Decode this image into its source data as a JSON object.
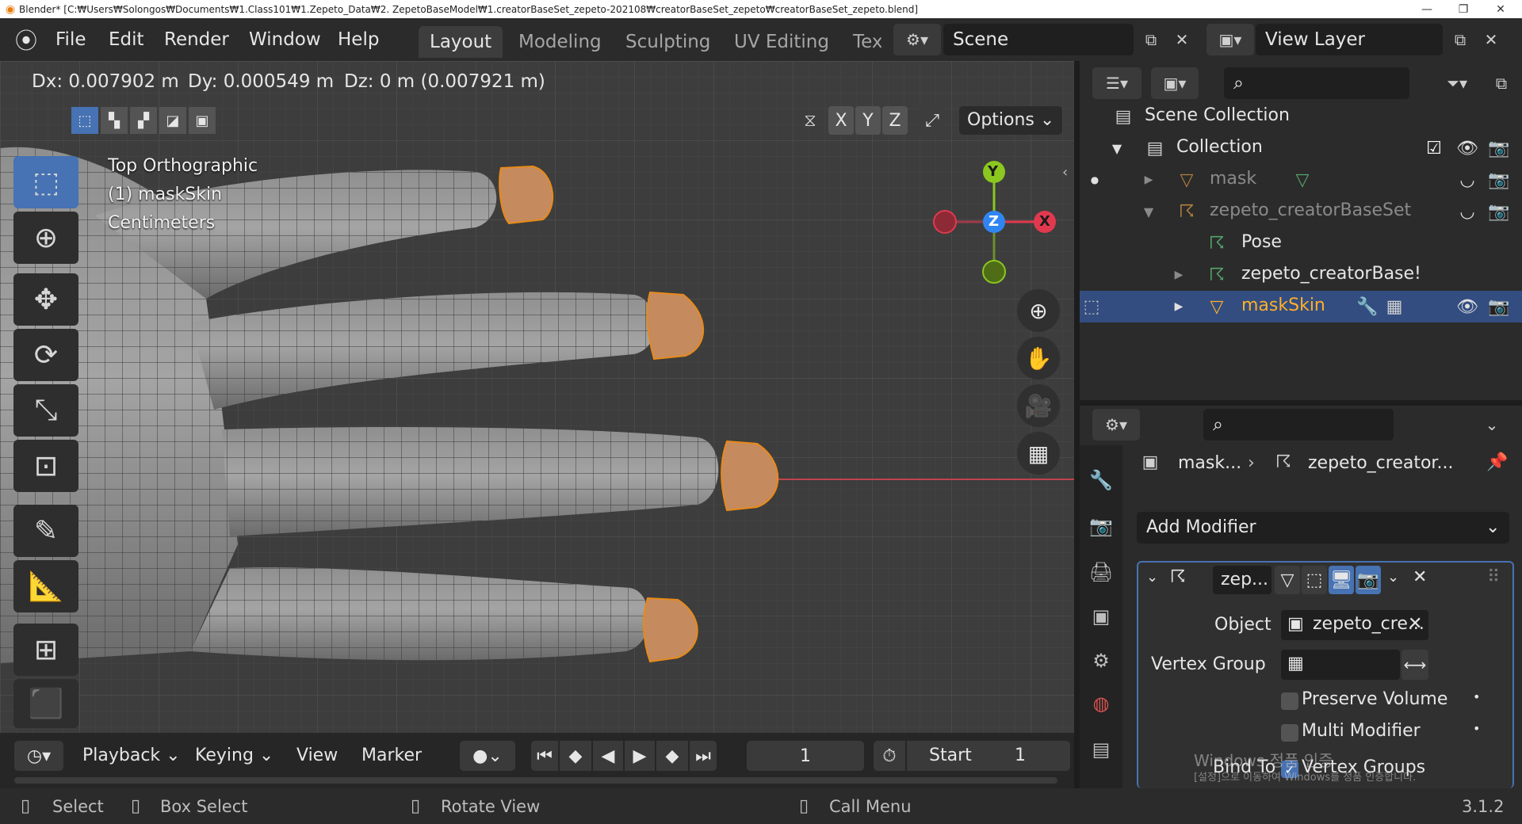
{
  "titlebar": {
    "title": "Blender* [C:₩Users₩Solongos₩Documents₩1.Class101₩1.Zepeto_Data₩2. ZepetoBaseModel₩1.creatorBaseSet_zepeto-202108₩creatorBaseSet_zepeto₩creatorBaseSet_zepeto.blend]"
  },
  "menu": {
    "items": [
      "File",
      "Edit",
      "Render",
      "Window",
      "Help"
    ]
  },
  "workspaces": {
    "tabs": [
      "Layout",
      "Modeling",
      "Sculpting",
      "UV Editing",
      "Tex"
    ],
    "active": "Layout"
  },
  "scene": {
    "label": "Scene"
  },
  "view_layer": {
    "label": "View Layer"
  },
  "viewport": {
    "header_delta": {
      "dx": "Dx: 0.007902 m",
      "dy": "Dy: 0.000549 m",
      "dz": "Dz: 0 m (0.007921 m)"
    },
    "axes": [
      "X",
      "Y",
      "Z"
    ],
    "options_label": "Options",
    "overlay": {
      "view_name": "Top Orthographic",
      "object": "(1) maskSkin",
      "units": "Centimeters"
    },
    "gizmo": {
      "y": "Y",
      "z": "Z",
      "x": "X"
    }
  },
  "timeline": {
    "playback": "Playback",
    "keying": "Keying",
    "view": "View",
    "marker": "Marker",
    "current_frame": "1",
    "start_label": "Start",
    "start_value": "1"
  },
  "statusbar": {
    "select": "Select",
    "box_select": "Box Select",
    "rotate_view": "Rotate View",
    "call_menu": "Call Menu",
    "version": "3.1.2"
  },
  "outliner": {
    "scene_collection": "Scene Collection",
    "collection": "Collection",
    "rows": [
      "mask",
      "zepeto_creatorBaseSet",
      "Pose",
      "zepeto_creatorBase!",
      "maskSkin"
    ]
  },
  "properties": {
    "breadcrumb_object": "mask...",
    "breadcrumb_armature": "zepeto_creator...",
    "add_modifier": "Add Modifier",
    "modifier_name": "zep...",
    "object_label": "Object",
    "object_value": "zepeto_cre...",
    "vertex_group_label": "Vertex Group",
    "preserve_volume": "Preserve Volume",
    "multi_modifier": "Multi Modifier",
    "bind_to": "Bind To",
    "vertex_groups": "Vertex Groups"
  },
  "watermark": {
    "line1": "Windows 정품 인증",
    "line2": "[설정]으로 이동하여 Windows를 정품 인증합니다."
  },
  "colors": {
    "accent_blue": "#4772b3",
    "selected_orange": "#ffaf29",
    "axis_x": "#e0394f",
    "axis_y": "#8bc71e",
    "axis_z": "#2f86f2"
  }
}
